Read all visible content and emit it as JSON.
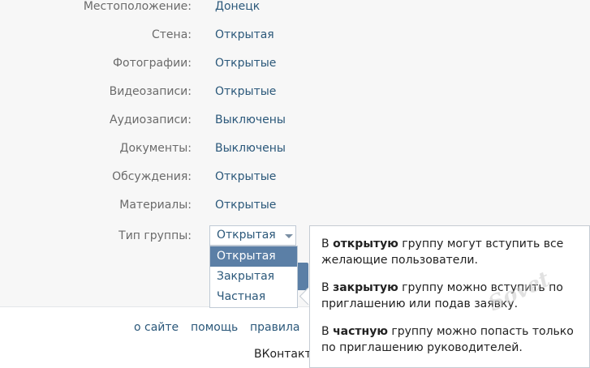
{
  "settings": [
    {
      "label": "Местоположение:",
      "value": "Донецк"
    },
    {
      "label": "Стена:",
      "value": "Открытая"
    },
    {
      "label": "Фотографии:",
      "value": "Открытые"
    },
    {
      "label": "Видеозаписи:",
      "value": "Открытые"
    },
    {
      "label": "Аудиозаписи:",
      "value": "Выключены"
    },
    {
      "label": "Документы:",
      "value": "Выключены"
    },
    {
      "label": "Обсуждения:",
      "value": "Открытые"
    },
    {
      "label": "Материалы:",
      "value": "Открытые"
    }
  ],
  "group_type": {
    "label": "Тип группы:",
    "selected": "Открытая",
    "options": [
      "Открытая",
      "Закрытая",
      "Частная"
    ]
  },
  "tooltip": [
    {
      "pre": "В ",
      "bold": "открытую",
      "post": " группу могут вступить все желающие пользователи."
    },
    {
      "pre": "В ",
      "bold": "закрытую",
      "post": " группу можно вступить по приглашению или подав заявку."
    },
    {
      "pre": "В ",
      "bold": "частную",
      "post": " группу можно попасть только по приглашению руководителей."
    }
  ],
  "footer": {
    "links": [
      "о сайте",
      "помощь",
      "правила"
    ],
    "brand": "ВКонтакте"
  },
  "watermark": "Sovet"
}
